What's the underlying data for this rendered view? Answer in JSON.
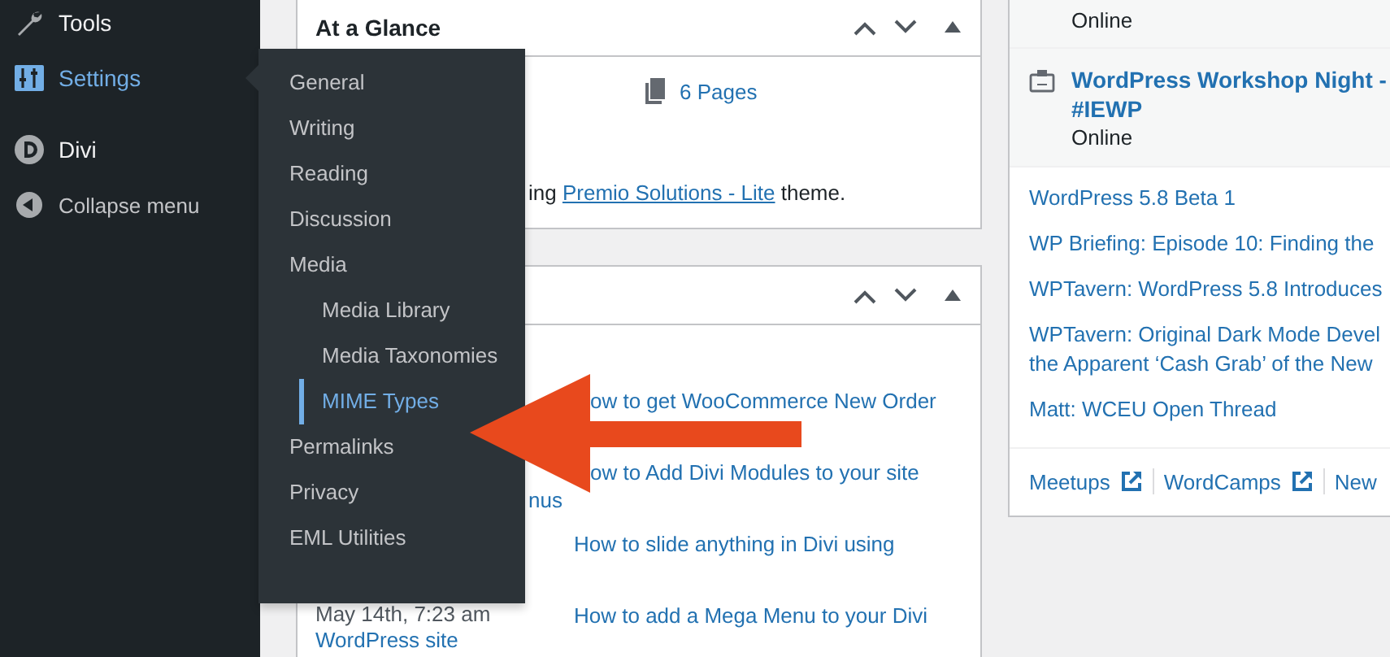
{
  "sidebar": {
    "items": [
      {
        "label": "Tools",
        "selected": false
      },
      {
        "label": "Settings",
        "selected": true
      },
      {
        "label": "Divi",
        "selected": false
      }
    ],
    "collapse_label": "Collapse menu"
  },
  "settings_flyout": {
    "items": [
      {
        "label": "General",
        "selected": false
      },
      {
        "label": "Writing",
        "selected": false
      },
      {
        "label": "Reading",
        "selected": false
      },
      {
        "label": "Discussion",
        "selected": false
      },
      {
        "label": "Media",
        "selected": false,
        "children": [
          {
            "label": "Media Library",
            "selected": false
          },
          {
            "label": "Media Taxonomies",
            "selected": false
          },
          {
            "label": "MIME Types",
            "selected": true
          }
        ]
      },
      {
        "label": "Permalinks",
        "selected": false
      },
      {
        "label": "Privacy",
        "selected": false
      },
      {
        "label": "EML Utilities",
        "selected": false
      }
    ]
  },
  "at_a_glance": {
    "title": "At a Glance",
    "pages_link": "6 Pages",
    "theme_text_start": "ing",
    "theme_link": "Premio Solutions - Lite",
    "theme_text_end": "theme."
  },
  "activity": {
    "rows": [
      {
        "left": [],
        "link": "ow to get WooCommerce New Order"
      },
      {
        "left": [
          {
            "kind": "link",
            "text": "nus"
          }
        ],
        "link": "ow to Add Divi Modules to your site"
      },
      {
        "left": [],
        "link": "How to slide anything in Divi using"
      },
      {
        "left": [
          {
            "kind": "text",
            "text": "May 14th, 7:23 am"
          },
          {
            "kind": "link",
            "text": "WordPress site"
          }
        ],
        "link": "How to add a Mega Menu to your Divi"
      }
    ]
  },
  "events": {
    "items": [
      {
        "location": "Online"
      },
      {
        "title": "WordPress Workshop Night - #IEWP",
        "location": "Online"
      }
    ],
    "news": [
      "WordPress 5.8 Beta 1",
      "WP Briefing: Episode 10: Finding the",
      "WPTavern: WordPress 5.8 Introduces",
      "WPTavern: Original Dark Mode Devel the Apparent ‘Cash Grab’ of the New",
      "Matt: WCEU Open Thread"
    ],
    "footer_links": [
      {
        "label": "Meetups",
        "external": true
      },
      {
        "label": "WordCamps",
        "external": true
      },
      {
        "label": "New",
        "external": false
      }
    ]
  }
}
